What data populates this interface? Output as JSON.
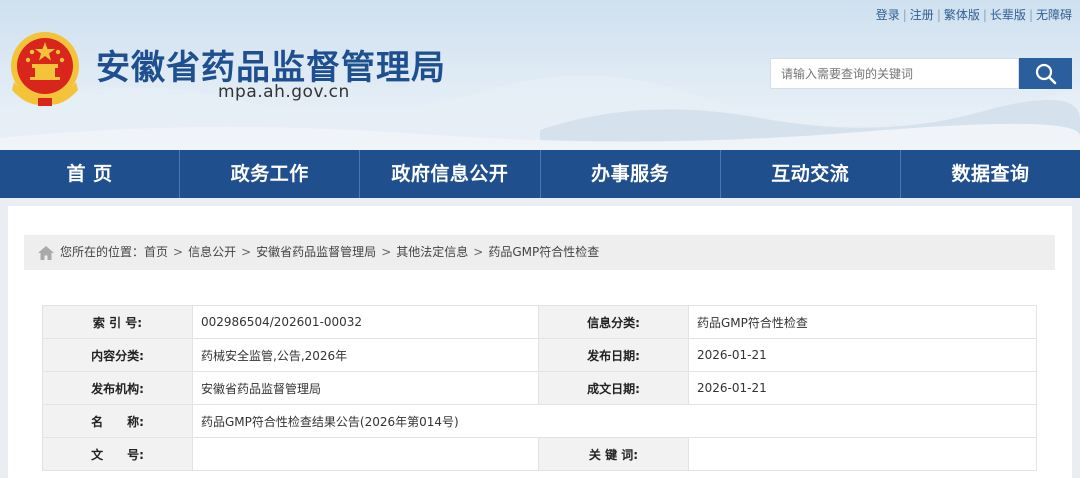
{
  "top_links": [
    "登录",
    "注册",
    "繁体版",
    "长辈版",
    "无障碍"
  ],
  "site": {
    "title": "安徽省药品监督管理局",
    "domain": "mpa.ah.gov.cn"
  },
  "search": {
    "placeholder": "请输入需要查询的关键词",
    "icon": "search-icon"
  },
  "colors": {
    "nav_bg": "#1f4f8c",
    "title": "#1e4f8f",
    "search_button": "#2b5e9d",
    "emblem_red": "#d8261c",
    "emblem_gold": "#f3c33a"
  },
  "nav": {
    "items": [
      "首 页",
      "政务工作",
      "政府信息公开",
      "办事服务",
      "互动交流",
      "数据查询"
    ]
  },
  "breadcrumb": {
    "lead": "您所在的位置：",
    "items": [
      "首页",
      "信息公开",
      "安徽省药品监督管理局",
      "其他法定信息",
      "药品GMP符合性检查"
    ],
    "separator": ">",
    "icon": "home-icon"
  },
  "info_table": {
    "rows": [
      {
        "label1": "索 引 号:",
        "value1": "002986504/202601-00032",
        "label2": "信息分类:",
        "value2": "药品GMP符合性检查"
      },
      {
        "label1": "内容分类:",
        "value1": "药械安全监管,公告,2026年",
        "label2": "发布日期:",
        "value2": "2026-01-21"
      },
      {
        "label1": "发布机构:",
        "value1": "安徽省药品监督管理局",
        "label2": "成文日期:",
        "value2": "2026-01-21"
      },
      {
        "label1": "名　　称:",
        "value1": "药品GMP符合性检查结果公告(2026年第014号)"
      },
      {
        "label1": "文　　号:",
        "value1": "",
        "label2": "关 键 词:",
        "value2": ""
      }
    ]
  }
}
